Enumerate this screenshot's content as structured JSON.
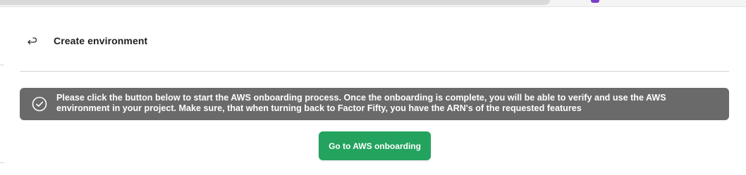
{
  "header": {
    "title": "Create environment",
    "back_icon": "return-arrow-icon"
  },
  "info": {
    "icon": "check-circle-icon",
    "message": "Please click the button below to start the AWS onboarding process. Once the onboarding is complete, you will be able to verify and use the AWS environment in your project. Make sure, that when turning back to Factor Fifty, you have the ARN's of the requested features"
  },
  "actions": {
    "primary_label": "Go to AWS onboarding"
  },
  "colors": {
    "info_background": "#6a6a6a",
    "primary_button": "#23a35e",
    "accent_purple": "#7a3fc9"
  }
}
